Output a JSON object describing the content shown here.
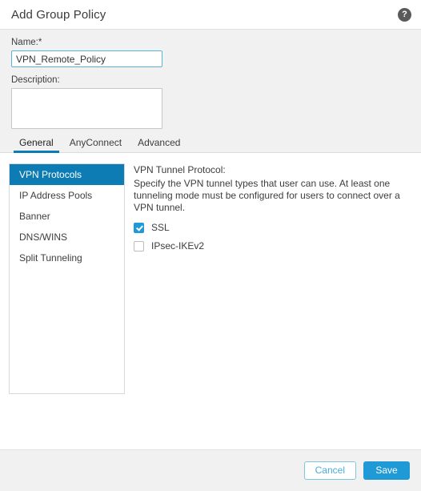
{
  "header": {
    "title": "Add Group Policy",
    "help_icon": "help-circle-icon",
    "help_glyph": "?"
  },
  "form": {
    "name_label": "Name:*",
    "name_value": "VPN_Remote_Policy",
    "name_placeholder": "",
    "description_label": "Description:",
    "description_value": "",
    "description_placeholder": ""
  },
  "tabs": [
    {
      "label": "General",
      "active": true
    },
    {
      "label": "AnyConnect",
      "active": false
    },
    {
      "label": "Advanced",
      "active": false
    }
  ],
  "side_nav": {
    "items": [
      {
        "label": "VPN Protocols",
        "active": true
      },
      {
        "label": "IP Address Pools",
        "active": false
      },
      {
        "label": "Banner",
        "active": false
      },
      {
        "label": "DNS/WINS",
        "active": false
      },
      {
        "label": "Split Tunneling",
        "active": false
      }
    ]
  },
  "content": {
    "title": "VPN Tunnel Protocol:",
    "description": "Specify the VPN tunnel types that user can use. At least one tunneling mode must be configured for users to connect over a VPN tunnel.",
    "checkboxes": [
      {
        "label": "SSL",
        "checked": true
      },
      {
        "label": "IPsec-IKEv2",
        "checked": false
      }
    ]
  },
  "footer": {
    "cancel_label": "Cancel",
    "save_label": "Save"
  },
  "colors": {
    "accent_blue": "#0d7cb5",
    "button_blue": "#1f9ad6",
    "panel_gray": "#f1f1f1"
  }
}
